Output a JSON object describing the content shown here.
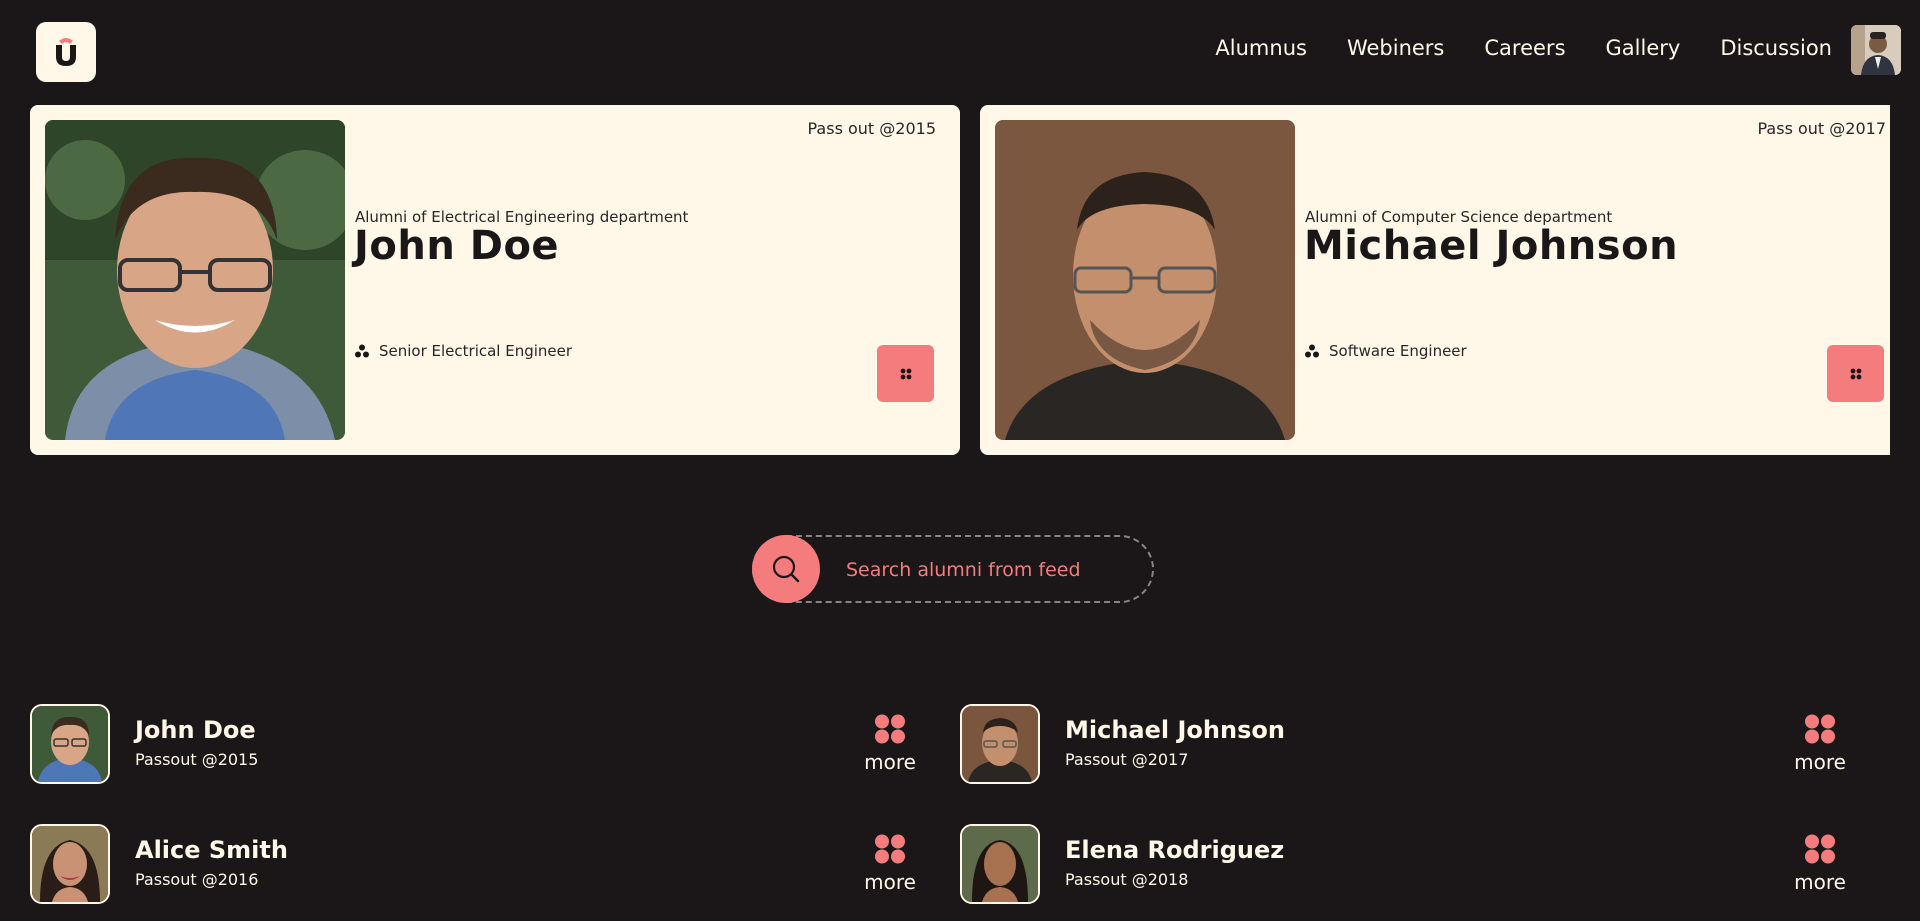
{
  "nav": {
    "items": [
      "Alumnus",
      "Webiners",
      "Careers",
      "Gallery",
      "Discussion"
    ]
  },
  "featured": [
    {
      "passout": "Pass out @2015",
      "department": "Alumni of Electrical Engineering department",
      "name": "John Doe",
      "role": "Senior Electrical Engineer"
    },
    {
      "passout": "Pass out @2017",
      "department": "Alumni of Computer Science department",
      "name": "Michael Johnson",
      "role": "Software Engineer"
    }
  ],
  "search": {
    "placeholder": "Search alumni from feed"
  },
  "alumni": [
    {
      "name": "John Doe",
      "passout": "Passout @2015",
      "more": "more"
    },
    {
      "name": "Michael Johnson",
      "passout": "Passout @2017",
      "more": "more"
    },
    {
      "name": "Alice Smith",
      "passout": "Passout @2016",
      "more": "more"
    },
    {
      "name": "Elena Rodriguez",
      "passout": "Passout @2018",
      "more": "more"
    }
  ],
  "colors": {
    "background": "#1b1718",
    "card": "#fff8e8",
    "accent": "#f47c7c"
  }
}
